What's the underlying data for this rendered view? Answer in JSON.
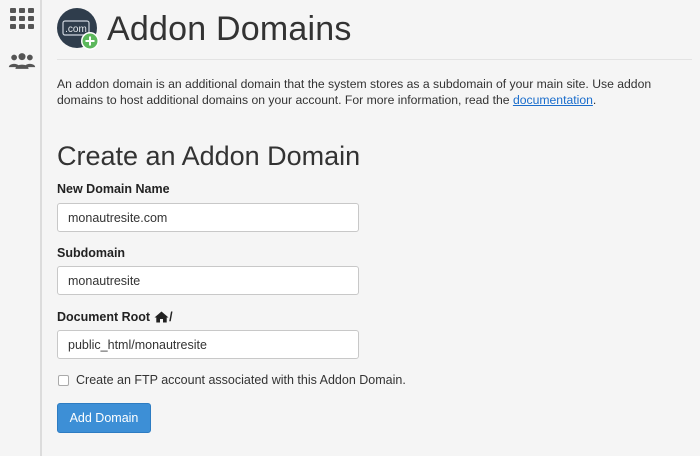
{
  "sidebar": {
    "items": [
      {
        "icon": "grid-icon"
      },
      {
        "icon": "users-icon"
      }
    ]
  },
  "header": {
    "title": "Addon Domains",
    "logo_text": ".com",
    "logo_icon": "addon-domain-icon"
  },
  "intro": {
    "text": "An addon domain is an additional domain that the system stores as a subdomain of your main site. Use addon domains to host additional domains on your account. For more information, read the ",
    "link_label": "documentation",
    "suffix": "."
  },
  "form": {
    "title": "Create an Addon Domain",
    "new_domain": {
      "label": "New Domain Name",
      "value": "monautresite.com"
    },
    "subdomain": {
      "label": "Subdomain",
      "value": "monautresite"
    },
    "document_root": {
      "label": "Document Root",
      "suffix": "/",
      "icon": "home-icon",
      "value": "public_html/monautresite"
    },
    "ftp_checkbox": {
      "label": "Create an FTP account associated with this Addon Domain.",
      "checked": false
    },
    "submit_label": "Add Domain"
  },
  "colors": {
    "accent": "#3d8fd6",
    "link": "#1a6dcc",
    "logo_bg": "#2f3d4c",
    "logo_badge": "#5cb85c"
  }
}
